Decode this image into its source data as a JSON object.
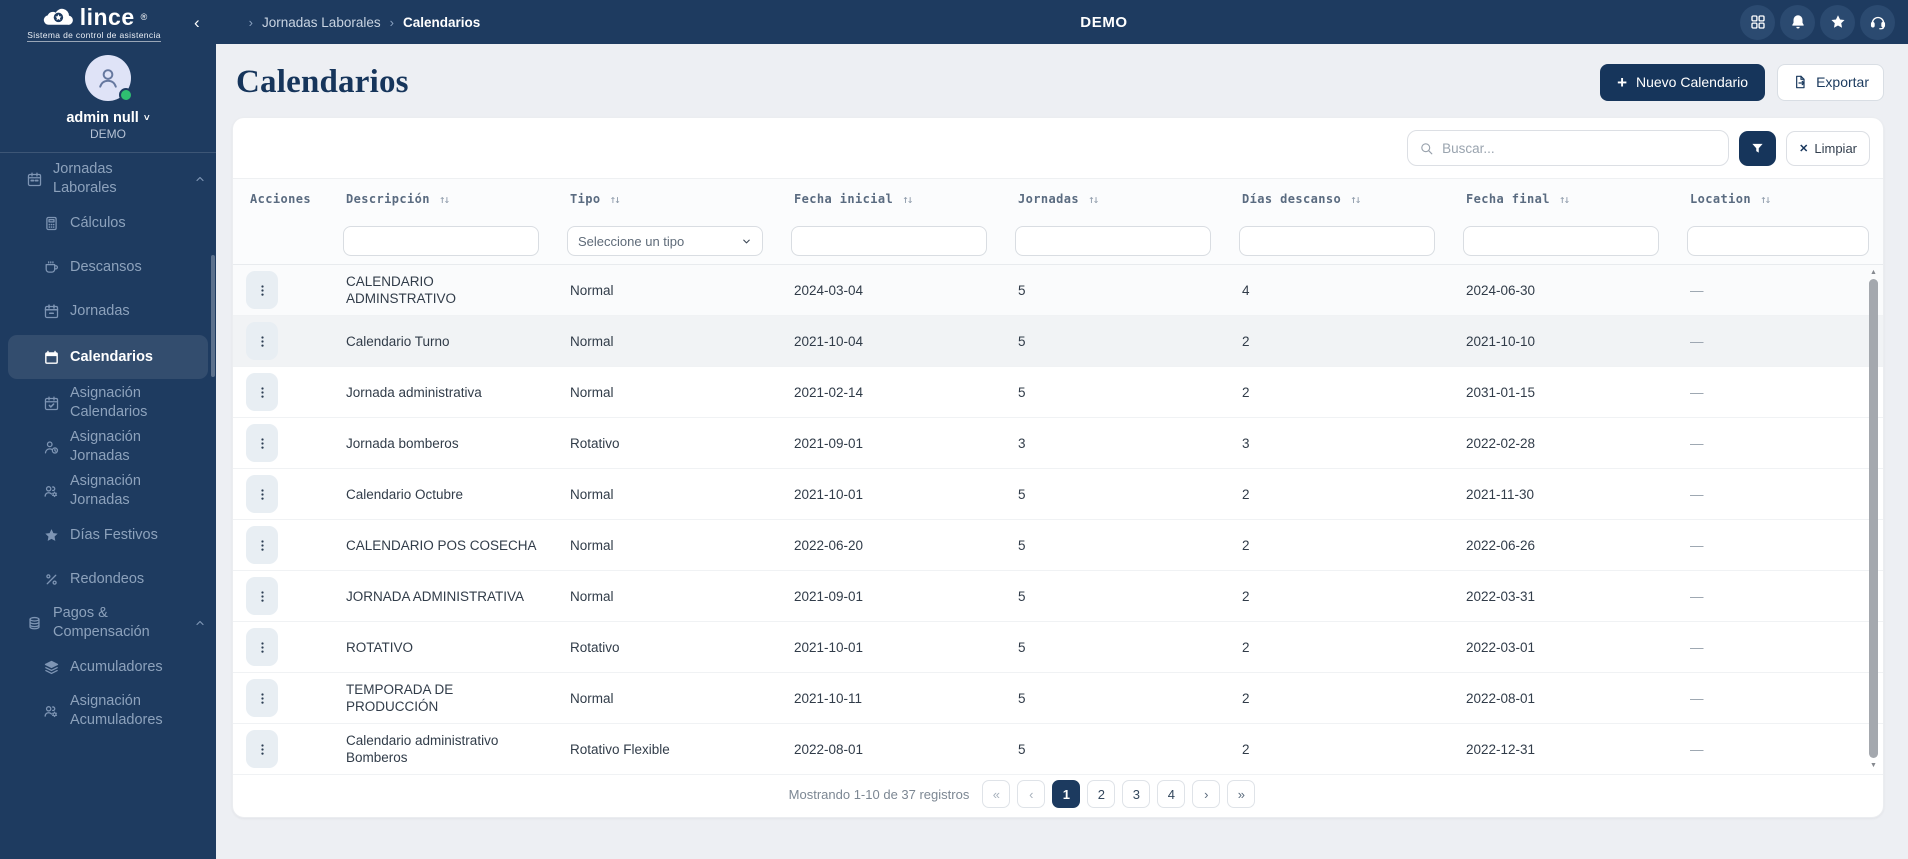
{
  "brand": {
    "name": "lince",
    "registered": "®",
    "tagline": "Sistema de control de asistencia"
  },
  "topbar": {
    "breadcrumb": [
      "Jornadas Laborales",
      "Calendarios"
    ],
    "environment": "DEMO",
    "action_icons": [
      "apps",
      "notifications",
      "favorites",
      "support"
    ]
  },
  "user": {
    "name": "admin null",
    "org": "DEMO"
  },
  "sidebar": {
    "items": [
      {
        "label": "Jornadas Laborales",
        "icon": "calendar-week",
        "type": "group",
        "expanded": true
      },
      {
        "label": "Cálculos",
        "icon": "calculator",
        "type": "sub"
      },
      {
        "label": "Descansos",
        "icon": "coffee",
        "type": "sub"
      },
      {
        "label": "Jornadas",
        "icon": "calendar-minus",
        "type": "sub"
      },
      {
        "label": "Calendarios",
        "icon": "calendar-solid",
        "type": "sub",
        "active": true
      },
      {
        "label": "Asignación Calendarios",
        "icon": "calendar-check",
        "type": "sub"
      },
      {
        "label": "Asignación Jornadas",
        "icon": "user-clock",
        "type": "sub"
      },
      {
        "label": "Asignación Jornadas",
        "icon": "users-gear",
        "type": "sub"
      },
      {
        "label": "Días Festivos",
        "icon": "star",
        "type": "sub"
      },
      {
        "label": "Redondeos",
        "icon": "percent",
        "type": "sub"
      },
      {
        "label": "Pagos & Compensación",
        "icon": "coins",
        "type": "group",
        "expanded": true
      },
      {
        "label": "Acumuladores",
        "icon": "layers",
        "type": "sub"
      },
      {
        "label": "Asignación Acumuladores",
        "icon": "users-gear",
        "type": "sub"
      }
    ]
  },
  "page": {
    "title": "Calendarios",
    "new_button_label": "Nuevo Calendario",
    "export_button_label": "Exportar"
  },
  "toolbar": {
    "search_placeholder": "Buscar...",
    "clear_button_label": "Limpiar"
  },
  "table": {
    "columns": [
      {
        "label": "Acciones",
        "sortable": false,
        "filter": "none"
      },
      {
        "label": "Descripción",
        "sortable": true,
        "filter": "text"
      },
      {
        "label": "Tipo",
        "sortable": true,
        "filter": "select",
        "filter_placeholder": "Seleccione un tipo"
      },
      {
        "label": "Fecha inicial",
        "sortable": true,
        "filter": "text"
      },
      {
        "label": "Jornadas",
        "sortable": true,
        "filter": "text"
      },
      {
        "label": "Días descanso",
        "sortable": true,
        "filter": "text"
      },
      {
        "label": "Fecha final",
        "sortable": true,
        "filter": "text"
      },
      {
        "label": "Location",
        "sortable": true,
        "filter": "text"
      }
    ],
    "rows": [
      {
        "descripcion": "CALENDARIO ADMINSTRATIVO",
        "tipo": "Normal",
        "fecha_inicial": "2024-03-04",
        "jornadas": "5",
        "dias_descanso": "4",
        "fecha_final": "2024-06-30",
        "location": "—"
      },
      {
        "descripcion": "Calendario Turno",
        "tipo": "Normal",
        "fecha_inicial": "2021-10-04",
        "jornadas": "5",
        "dias_descanso": "2",
        "fecha_final": "2021-10-10",
        "location": "—"
      },
      {
        "descripcion": "Jornada administrativa",
        "tipo": "Normal",
        "fecha_inicial": "2021-02-14",
        "jornadas": "5",
        "dias_descanso": "2",
        "fecha_final": "2031-01-15",
        "location": "—"
      },
      {
        "descripcion": "Jornada bomberos",
        "tipo": "Rotativo",
        "fecha_inicial": "2021-09-01",
        "jornadas": "3",
        "dias_descanso": "3",
        "fecha_final": "2022-02-28",
        "location": "—"
      },
      {
        "descripcion": "Calendario Octubre",
        "tipo": "Normal",
        "fecha_inicial": "2021-10-01",
        "jornadas": "5",
        "dias_descanso": "2",
        "fecha_final": "2021-11-30",
        "location": "—"
      },
      {
        "descripcion": "CALENDARIO POS COSECHA",
        "tipo": "Normal",
        "fecha_inicial": "2022-06-20",
        "jornadas": "5",
        "dias_descanso": "2",
        "fecha_final": "2022-06-26",
        "location": "—"
      },
      {
        "descripcion": "JORNADA ADMINISTRATIVA",
        "tipo": "Normal",
        "fecha_inicial": "2021-09-01",
        "jornadas": "5",
        "dias_descanso": "2",
        "fecha_final": "2022-03-31",
        "location": "—"
      },
      {
        "descripcion": "ROTATIVO",
        "tipo": "Rotativo",
        "fecha_inicial": "2021-10-01",
        "jornadas": "5",
        "dias_descanso": "2",
        "fecha_final": "2022-03-01",
        "location": "—"
      },
      {
        "descripcion": "TEMPORADA DE PRODUCCIÓN",
        "tipo": "Normal",
        "fecha_inicial": "2021-10-11",
        "jornadas": "5",
        "dias_descanso": "2",
        "fecha_final": "2022-08-01",
        "location": "—"
      },
      {
        "descripcion": "Calendario administrativo Bomberos",
        "tipo": "Rotativo Flexible",
        "fecha_inicial": "2022-08-01",
        "jornadas": "5",
        "dias_descanso": "2",
        "fecha_final": "2022-12-31",
        "location": "—"
      }
    ]
  },
  "pagination": {
    "summary": "Mostrando 1-10 de 37 registros",
    "first": "«",
    "prev": "‹",
    "next": "›",
    "last": "»",
    "pages": [
      "1",
      "2",
      "3",
      "4"
    ],
    "active_page": "1"
  },
  "glyphs": {
    "sort": "↑↓",
    "close": "✕",
    "plus": "+",
    "breadcrumb_sep": "›",
    "collapse": "‹",
    "scroll_up": "▲",
    "scroll_down": "▼",
    "user_caret": "˅"
  },
  "colors": {
    "navy": "#1e3b60",
    "accent": "#16355b",
    "green": "#2fbf71"
  }
}
